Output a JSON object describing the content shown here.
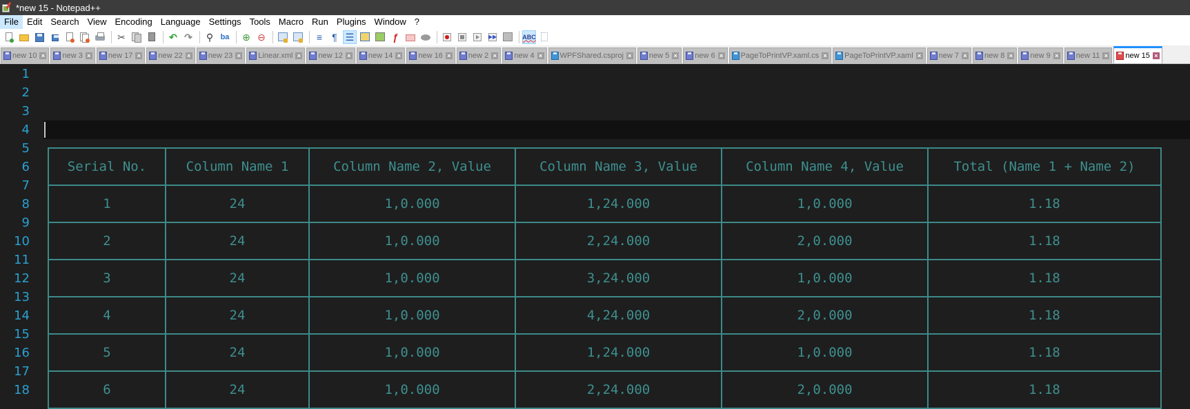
{
  "window": {
    "title": "*new 15 - Notepad++"
  },
  "menu": [
    "File",
    "Edit",
    "Search",
    "View",
    "Encoding",
    "Language",
    "Settings",
    "Tools",
    "Macro",
    "Run",
    "Plugins",
    "Window",
    "?"
  ],
  "toolbar": {
    "groups": [
      [
        "new-file",
        "open-file",
        "save",
        "save-all",
        "close",
        "close-all",
        "print"
      ],
      [
        "cut",
        "copy",
        "paste"
      ],
      [
        "undo",
        "redo"
      ],
      [
        "find",
        "replace"
      ],
      [
        "zoom-in",
        "zoom-out"
      ],
      [
        "sync-vertical",
        "sync-horizontal"
      ],
      [
        "word-wrap",
        "show-all-characters"
      ],
      [
        "indent-guide",
        "user-defined-language",
        "document-map",
        "function-list",
        "folder-as-workspace",
        "monitoring"
      ],
      [
        "record-macro",
        "stop-recording",
        "play-macro",
        "run-macro-multiple",
        "save-macro"
      ],
      [
        "spell-check",
        "next-misspelling"
      ]
    ],
    "active": [
      "indent-guide",
      "spell-check"
    ]
  },
  "tabs": [
    {
      "label": "new 10",
      "kind": "unsaved"
    },
    {
      "label": "new 3",
      "kind": "unsaved"
    },
    {
      "label": "new 17",
      "kind": "unsaved"
    },
    {
      "label": "new 22",
      "kind": "unsaved"
    },
    {
      "label": "new 23",
      "kind": "unsaved"
    },
    {
      "label": "Linear.xml",
      "kind": "unsaved"
    },
    {
      "label": "new 12",
      "kind": "unsaved"
    },
    {
      "label": "new 14",
      "kind": "unsaved"
    },
    {
      "label": "new 16",
      "kind": "unsaved"
    },
    {
      "label": "new 2",
      "kind": "unsaved"
    },
    {
      "label": "new 4",
      "kind": "unsaved"
    },
    {
      "label": "WPFShared.csproj",
      "kind": "saved"
    },
    {
      "label": "new 5",
      "kind": "unsaved"
    },
    {
      "label": "new 6",
      "kind": "unsaved"
    },
    {
      "label": "PageToPrintVP.xaml.cs",
      "kind": "saved"
    },
    {
      "label": "PageToPrintVP.xaml",
      "kind": "saved"
    },
    {
      "label": "new 7",
      "kind": "unsaved"
    },
    {
      "label": "new 8",
      "kind": "unsaved"
    },
    {
      "label": "new 9",
      "kind": "unsaved"
    },
    {
      "label": "new 11",
      "kind": "unsaved"
    },
    {
      "label": "new 15",
      "kind": "modified",
      "active": true
    }
  ],
  "editor": {
    "line_numbers": [
      "1",
      "2",
      "3",
      "4",
      "5",
      "6",
      "7",
      "8",
      "9",
      "10",
      "11",
      "12",
      "13",
      "14",
      "15",
      "16",
      "17",
      "18"
    ],
    "current_line": "4",
    "table": {
      "headers": [
        "Serial No.",
        "Column Name 1",
        "Column Name 2, Value",
        "Column Name 3, Value",
        "Column Name 4, Value",
        "Total (Name 1 + Name 2)"
      ],
      "rows": [
        [
          "1",
          "24",
          "1,0.000",
          "1,24.000",
          "1,0.000",
          "1.18"
        ],
        [
          "2",
          "24",
          "1,0.000",
          "2,24.000",
          "2,0.000",
          "1.18"
        ],
        [
          "3",
          "24",
          "1,0.000",
          "3,24.000",
          "1,0.000",
          "1.18"
        ],
        [
          "4",
          "24",
          "1,0.000",
          "4,24.000",
          "2,0.000",
          "1.18"
        ],
        [
          "5",
          "24",
          "1,0.000",
          "1,24.000",
          "1,0.000",
          "1.18"
        ],
        [
          "6",
          "24",
          "1,0.000",
          "2,24.000",
          "2,0.000",
          "1.18"
        ]
      ]
    }
  },
  "colors": {
    "editor_bg": "#1e1e1e",
    "line_number": "#2aa0d0",
    "table_text": "#3f8f8f",
    "table_border": "#3d8a8a",
    "active_tab_accent": "#1e90ff"
  }
}
